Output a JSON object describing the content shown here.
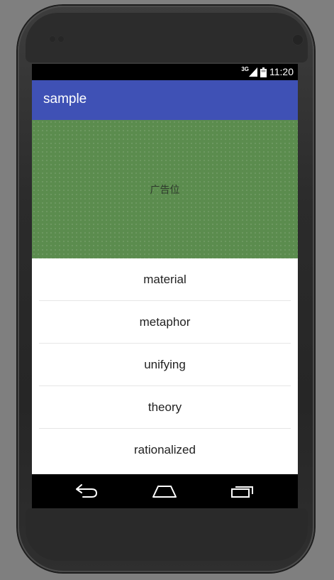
{
  "status_bar": {
    "network": "3G",
    "time": "11:20",
    "icons": [
      "signal-icon",
      "battery-icon"
    ]
  },
  "app_bar": {
    "title": "sample",
    "color": "#3f51b5"
  },
  "ad_banner": {
    "label": "广告位",
    "color": "#5b8c4e"
  },
  "list": {
    "items": [
      {
        "label": "material"
      },
      {
        "label": "metaphor"
      },
      {
        "label": "unifying"
      },
      {
        "label": "theory"
      },
      {
        "label": "rationalized"
      }
    ]
  },
  "nav_bar": {
    "buttons": [
      "back-icon",
      "home-icon",
      "recents-icon"
    ]
  }
}
